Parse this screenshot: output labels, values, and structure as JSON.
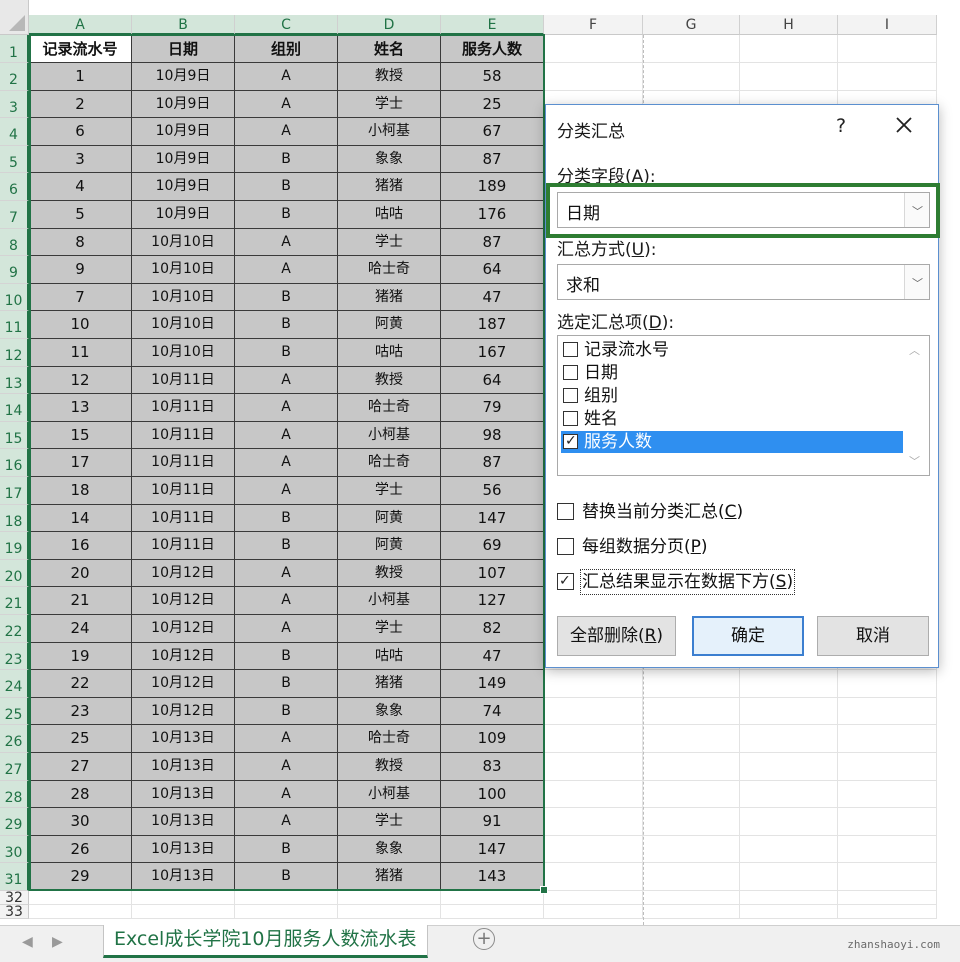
{
  "columns": [
    "A",
    "B",
    "C",
    "D",
    "E",
    "F",
    "G",
    "H",
    "I"
  ],
  "selected_columns": [
    "A",
    "B",
    "C",
    "D",
    "E"
  ],
  "row_numbers": [
    "1",
    "2",
    "3",
    "4",
    "5",
    "6",
    "7",
    "8",
    "9",
    "10",
    "11",
    "12",
    "13",
    "14",
    "15",
    "16",
    "17",
    "18",
    "19",
    "20",
    "21",
    "22",
    "23",
    "24",
    "25",
    "26",
    "27",
    "28",
    "29",
    "30",
    "31",
    "32",
    "33"
  ],
  "table": {
    "headers": [
      "记录流水号",
      "日期",
      "组别",
      "姓名",
      "服务人数"
    ],
    "rows": [
      [
        "1",
        "10月9日",
        "A",
        "教授",
        "58"
      ],
      [
        "2",
        "10月9日",
        "A",
        "学士",
        "25"
      ],
      [
        "6",
        "10月9日",
        "A",
        "小柯基",
        "67"
      ],
      [
        "3",
        "10月9日",
        "B",
        "象象",
        "87"
      ],
      [
        "4",
        "10月9日",
        "B",
        "猪猪",
        "189"
      ],
      [
        "5",
        "10月9日",
        "B",
        "咕咕",
        "176"
      ],
      [
        "8",
        "10月10日",
        "A",
        "学士",
        "87"
      ],
      [
        "9",
        "10月10日",
        "A",
        "哈士奇",
        "64"
      ],
      [
        "7",
        "10月10日",
        "B",
        "猪猪",
        "47"
      ],
      [
        "10",
        "10月10日",
        "B",
        "阿黄",
        "187"
      ],
      [
        "11",
        "10月10日",
        "B",
        "咕咕",
        "167"
      ],
      [
        "12",
        "10月11日",
        "A",
        "教授",
        "64"
      ],
      [
        "13",
        "10月11日",
        "A",
        "哈士奇",
        "79"
      ],
      [
        "15",
        "10月11日",
        "A",
        "小柯基",
        "98"
      ],
      [
        "17",
        "10月11日",
        "A",
        "哈士奇",
        "87"
      ],
      [
        "18",
        "10月11日",
        "A",
        "学士",
        "56"
      ],
      [
        "14",
        "10月11日",
        "B",
        "阿黄",
        "147"
      ],
      [
        "16",
        "10月11日",
        "B",
        "阿黄",
        "69"
      ],
      [
        "20",
        "10月12日",
        "A",
        "教授",
        "107"
      ],
      [
        "21",
        "10月12日",
        "A",
        "小柯基",
        "127"
      ],
      [
        "24",
        "10月12日",
        "A",
        "学士",
        "82"
      ],
      [
        "19",
        "10月12日",
        "B",
        "咕咕",
        "47"
      ],
      [
        "22",
        "10月12日",
        "B",
        "猪猪",
        "149"
      ],
      [
        "23",
        "10月12日",
        "B",
        "象象",
        "74"
      ],
      [
        "25",
        "10月13日",
        "A",
        "哈士奇",
        "109"
      ],
      [
        "27",
        "10月13日",
        "A",
        "教授",
        "83"
      ],
      [
        "28",
        "10月13日",
        "A",
        "小柯基",
        "100"
      ],
      [
        "30",
        "10月13日",
        "A",
        "学士",
        "91"
      ],
      [
        "26",
        "10月13日",
        "B",
        "象象",
        "147"
      ],
      [
        "29",
        "10月13日",
        "B",
        "猪猪",
        "143"
      ]
    ]
  },
  "sheet_tab": "Excel成长学院10月服务人数流水表",
  "add_sheet_glyph": "+",
  "nav_prev": "◀",
  "nav_next": "▶",
  "watermark": "zhanshaoyi.com",
  "dialog": {
    "title": "分类汇总",
    "help": "?",
    "group_by_label": "分类字段",
    "group_by_key": "A",
    "group_by_value": "日期",
    "function_label": "汇总方式",
    "function_key": "U",
    "function_value": "求和",
    "add_to_label": "选定汇总项",
    "add_to_key": "D",
    "fields": [
      {
        "label": "记录流水号",
        "checked": false,
        "selected": false
      },
      {
        "label": "日期",
        "checked": false,
        "selected": false
      },
      {
        "label": "组别",
        "checked": false,
        "selected": false
      },
      {
        "label": "姓名",
        "checked": false,
        "selected": false
      },
      {
        "label": "服务人数",
        "checked": true,
        "selected": true
      }
    ],
    "options": [
      {
        "label": "替换当前分类汇总",
        "key": "C",
        "checked": false
      },
      {
        "label": "每组数据分页",
        "key": "P",
        "checked": false
      },
      {
        "label": "汇总结果显示在数据下方",
        "key": "S",
        "checked": true
      }
    ],
    "remove_all_label": "全部删除",
    "remove_all_key": "R",
    "ok_label": "确定",
    "cancel_label": "取消",
    "check_glyph": "✓",
    "dropdown_glyph": "﹀",
    "scroll_up_glyph": "︿",
    "scroll_down_glyph": "﹀"
  },
  "colors": {
    "excel_green": "#217346",
    "highlight_frame": "#2e7d32",
    "selection_blue": "#2f8ff0",
    "table_fill": "#c7c7c7"
  }
}
